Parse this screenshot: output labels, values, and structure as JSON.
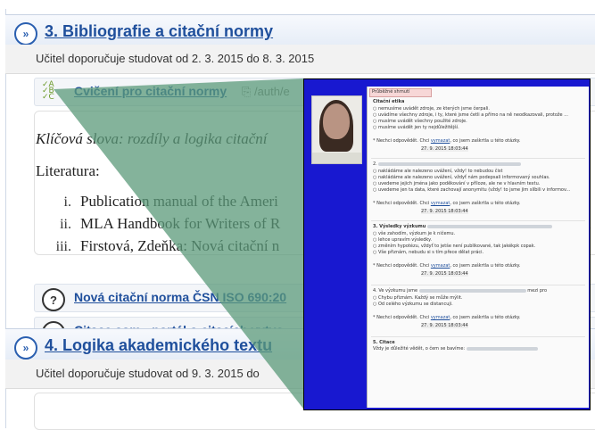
{
  "section3": {
    "number_title": "3. Bibliografie a citační normy",
    "teacher_note": "Učitel doporučuje studovat od 2. 3. 2015 do 8. 3. 2015",
    "quiz_link": "Cvičení pro citační normy",
    "quiz_path": "/auth/e",
    "quiz_path_tail": "ta",
    "keywords": "Klíčová slova: rozdíly a logika citační",
    "keywords_tail": "g",
    "literature_label": "Literatura:",
    "literature": [
      {
        "numeral": "i.",
        "text": "Publication manual of the Ameri",
        "tail": "a"
      },
      {
        "numeral": "ii.",
        "text": "MLA Handbook for Writers of R",
        "tail": "A"
      },
      {
        "numeral": "iii.",
        "text": "Firstová, Zdeňka: Nová citační n",
        "tail": "O"
      }
    ],
    "links": [
      {
        "label": "Nová citační norma ČSN ISO 690:20"
      },
      {
        "label": "Citace.com - portál o citacích vytvo"
      }
    ]
  },
  "section4": {
    "number_title": "4. Logika akademického textu",
    "teacher_note": "Učitel doporučuje studovat od 9. 3. 2015 do"
  },
  "overlay": {
    "tab_label": "Průběžné shrnutí",
    "q1_title": "Citační etika",
    "q1_options": [
      "nemusíme uvádět zdroje, ze kterých jsme čerpali.",
      "uvádíme všechny zdroje, i ty, které jsme četli a přímo na ně neodkazovali, protože ...",
      "musíme uvádět všechny použité zdroje.",
      "musíme uvádět jen ty nejdůležitější."
    ],
    "q2_number": "2.",
    "q2_options": [
      "nakládáme ale nalezeno uvážení, vždy! to nebudou čist",
      "nakládáme ale nalezeno uvážení, vždyť nám podepsali informovaný souhlas.",
      "uvedeme jejich jména jako poděkování v příloze, ale ne v hlavním textu.",
      "uvedeme jen ta data, které zachovají anonymitu (vždy! to jsme jim slíbili v informov..."
    ],
    "q3_title": "3. Výsledky výzkumu",
    "q3_options": [
      "vše zahodím, výzkum je k ničemu.",
      "lehce upravím výsledky.",
      "změním hypotézu, vždyť to jetše není publikované, tak jakékpk copak.",
      "Vše přiznám, nebudu si s tím přece dělat práci."
    ],
    "q4_intro": "4. Ve výzkumu jsme",
    "q4_intro_tail": "mezi pro",
    "q4_options": [
      "Chybu přiznám. Každý se může mýlit.",
      "Od celého výzkumu se distancuji."
    ],
    "q5_title": "5. Citace",
    "q5_text": "Vždy je důležité vědět, o čem se bavíme:",
    "no_answer": "* Nechci odpovědět. Chci",
    "no_answer_link": "vymazat",
    "no_answer_tail": ", co jsem zaškrtla u této otázky.",
    "timestamp": "27. 9. 2015 18:03:44"
  },
  "colors": {
    "link": "#1f4f9c",
    "overlay_blue": "#1818d0",
    "wedge_green": "#5b9a7a"
  }
}
